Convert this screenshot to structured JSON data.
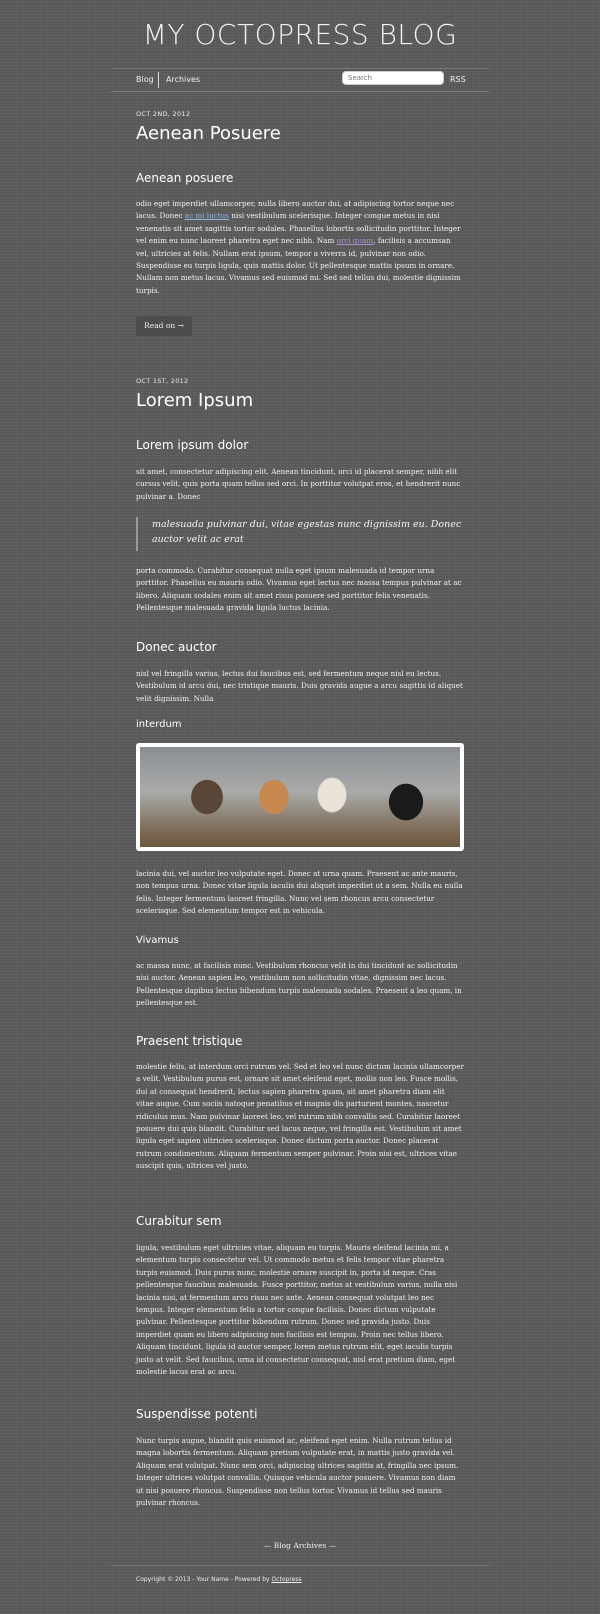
{
  "site": {
    "title": "MY OCTOPRESS BLOG"
  },
  "nav": {
    "blog": "Blog",
    "archives": "Archives",
    "search_placeholder": "Search",
    "rss": "RSS"
  },
  "post1": {
    "date": "OCT 2ND, 2012",
    "title": "Aenean Posuere",
    "subtitle": "Aenean posuere",
    "body_a": "odio eget imperdiet ullamcorper, nulla libero auctor dui, at adipiscing tortor neque nec lacus. Donec ",
    "link1": "ac mi luctus",
    "body_b": " nisi vestibulum scelerisque. Integer congue metus in nisi venenatis sit amet sagittis tortor sodales. Phasellus lobortis sollicitudin porttitor. Integer vel enim eu nunc laoreet pharetra eget nec nibh. Nam ",
    "link2": "orci quam",
    "body_c": ", facilisis a accumsan vel, ultricies at felis. Nullam erat ipsum, tempor a viverra id, pulvinar non odio. Suspendisse eu turpis ligula, quis mattis dolor. Ut pellentesque mattis ipsum in ornare. Nullam non metus lacus. Vivamus sed euismod mi. Sed sed tellus dui, molestie dignissim turpis.",
    "read_on": "Read on →"
  },
  "post2": {
    "date": "OCT 1ST, 2012",
    "title": "Lorem Ipsum",
    "h_lorem": "Lorem ipsum dolor",
    "p_lorem": "sit amet, consectetur adipiscing elit. Aenean tincidunt, orci id placerat semper, nibh elit cursus velit, quis porta quam tellus sed orci. In porttitor volutpat eros, et hendrerit nunc pulvinar a. Donec",
    "quote": "malesuada pulvinar dui, vitae egestas nunc dignissim eu. Donec auctor velit ac erat",
    "p_porta": "porta commodo. Curabitur consequat nulla eget ipsum malesuada id tempor urna porttitor. Phasellus eu mauris odio. Vivamus eget lectus nec massa tempus pulvinar at ac libero. Aliquam sodales enim sit amet risus posuere sed porttitor felis venenatis. Pellentesque malesuada gravida ligula luctus lacinia.",
    "h_donec": "Donec auctor",
    "p_donec": "nisl vel fringilla varius, lectus dui faucibus est, sed fermentum neque nisl eu lectus. Vestibulum id arcu dui, nec tristique mauris. Duis gravida augue a arcu sagittis id aliquet velit dignissim. Nulla",
    "h_interdum": "interdum",
    "p_lacinia": "lacinia dui, vel auctor leo vulputate eget. Donec at urna quam. Praesent ac ante mauris, non tempus urna. Donec vitae ligula iaculis dui aliquet imperdiet ut a sem. Nulla eu nulla felis. Integer fermentum laoreet fringilla. Nunc vel sem rhoncus arcu consectetur scelerisque. Sed elementum tempor est in vehicula.",
    "h_vivamus": "Vivamus",
    "p_vivamus": "ac massa nunc, at facilisis nunc. Vestibulum rhoncus velit in dui tincidunt ac sollicitudin nisi auctor. Aenean sapien leo, vestibulum non sollicitudin vitae, dignissim nec lacus. Pellentesque dapibus lectus bibendum turpis malesuada sodales. Praesent a leo quam, in pellentesque est.",
    "h_praesent": "Praesent tristique",
    "p_praesent": "molestie felis, at interdum orci rutrum vel. Sed et leo vel nunc dictum lacinia ullamcorper a velit. Vestibulum purus est, ornare sit amet eleifend eget, mollis non leo. Fusce mollis, dui at consequat hendrerit, lectus sapien pharetra quam, sit amet pharetra diam elit vitae augue. Cum sociis natoque penatibus et magnis dis parturient montes, nascetur ridiculus mus. Nam pulvinar laoreet leo, vel rutrum nibh convallis sed. Curabitur laoreet posuere dui quis blandit. Curabitur sed lacus neque, vel fringilla est. Vestibulum sit amet ligula eget sapien ultricies scelerisque. Donec dictum porta auctor. Donec placerat rutrum condimentum. Aliquam fermentum semper pulvinar. Proin nisi est, ultrices vitae suscipit quis, ultrices vel justo.",
    "h_curabitur": "Curabitur sem",
    "p_curabitur": "ligula, vestibulum eget ultricies vitae, aliquam eu turpis. Mauris eleifend lacinia mi, a elementum turpis consectetur vel. Ut commodo metus et felis tempor vitae pharetra turpis euismod. Duis purus nunc, molestie ornare suscipit in, porta id neque. Cras pellentesque faucibus malesuada. Fusce porttitor, metus at vestibulum varius, nulla nisi lacinia nisi, at fermentum arcu risus nec ante. Aenean consequat volutpat leo nec tempus. Integer elementum felis a tortor congue facilisis. Donec dictum vulputate pulvinar. Pellentesque porttitor bibendum rutrum. Donec sed gravida justo. Duis imperdiet quam eu libero adipiscing non facilisis est tempus. Proin nec tellus libero. Aliquam tincidunt, ligula id auctor semper, lorem metus rutrum elit, eget iaculis turpis justo at velit. Sed faucibus, urna id consectetur consequat, nisl erat pretium diam, eget molestie lacus erat ac arcu.",
    "h_suspendisse": "Suspendisse potenti",
    "p_suspendisse": "Nunc turpis augue, blandit quis euismod ac, eleifend eget enim. Nulla rutrum tellus id magna lobortis fermentum. Aliquam pretium vulputate erat, in mattis justo gravida vel. Aliquam erat volutpat. Nunc sem orci, adipiscing ultrices sagittis at, fringilla nec ipsum. Integer ultrices volutpat convallis. Quisque vehicula auctor posuere. Vivamus non diam ut nisi posuere rhoncus. Suspendisse non tellus tortor. Vivamus id tellus sed mauris pulvinar rhoncus."
  },
  "blog_archives": "— Blog Archives —",
  "footer": {
    "text": "Copyright © 2013 - Your Name - Powered by ",
    "link": "Octopress"
  }
}
